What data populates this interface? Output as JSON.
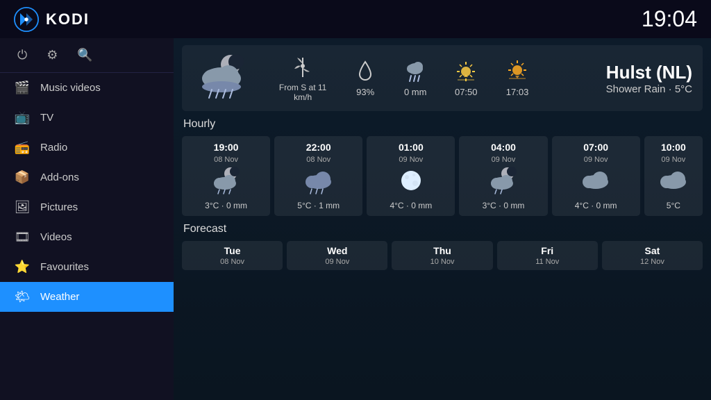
{
  "header": {
    "title": "KODI",
    "time": "19:04"
  },
  "sidebar": {
    "icons": [
      "power",
      "settings",
      "search"
    ],
    "items": [
      {
        "id": "music-videos",
        "label": "Music videos",
        "icon": "🎬"
      },
      {
        "id": "tv",
        "label": "TV",
        "icon": "📺"
      },
      {
        "id": "radio",
        "label": "Radio",
        "icon": "📻"
      },
      {
        "id": "add-ons",
        "label": "Add-ons",
        "icon": "📦"
      },
      {
        "id": "pictures",
        "label": "Pictures",
        "icon": "🖼"
      },
      {
        "id": "videos",
        "label": "Videos",
        "icon": "🎞"
      },
      {
        "id": "favourites",
        "label": "Favourites",
        "icon": "⭐"
      },
      {
        "id": "weather",
        "label": "Weather",
        "icon": "🌤",
        "active": true
      }
    ]
  },
  "weather": {
    "location": "Hulst (NL)",
    "condition": "Shower Rain · 5°C",
    "stats": [
      {
        "icon": "wind",
        "label": "From S at 11\nkm/h"
      },
      {
        "icon": "humidity",
        "label": "93%"
      },
      {
        "icon": "rain",
        "label": "0 mm"
      },
      {
        "icon": "sunrise",
        "label": "07:50"
      },
      {
        "icon": "sunset",
        "label": "17:03"
      }
    ],
    "hourly_label": "Hourly",
    "hourly": [
      {
        "time": "19:00",
        "date": "08 Nov",
        "temp": "3°C · 0 mm"
      },
      {
        "time": "22:00",
        "date": "08 Nov",
        "temp": "5°C · 1 mm"
      },
      {
        "time": "01:00",
        "date": "09 Nov",
        "temp": "4°C · 0 mm"
      },
      {
        "time": "04:00",
        "date": "09 Nov",
        "temp": "3°C · 0 mm"
      },
      {
        "time": "07:00",
        "date": "09 Nov",
        "temp": "4°C · 0 mm"
      },
      {
        "time": "10:00",
        "date": "09 Nov",
        "temp": "5°C"
      }
    ],
    "forecast_label": "Forecast",
    "forecast": [
      {
        "day": "Tue",
        "date": "08 Nov"
      },
      {
        "day": "Wed",
        "date": "09 Nov"
      },
      {
        "day": "Thu",
        "date": "10 Nov"
      },
      {
        "day": "Fri",
        "date": "11 Nov"
      },
      {
        "day": "Sat",
        "date": "12 Nov"
      }
    ]
  }
}
